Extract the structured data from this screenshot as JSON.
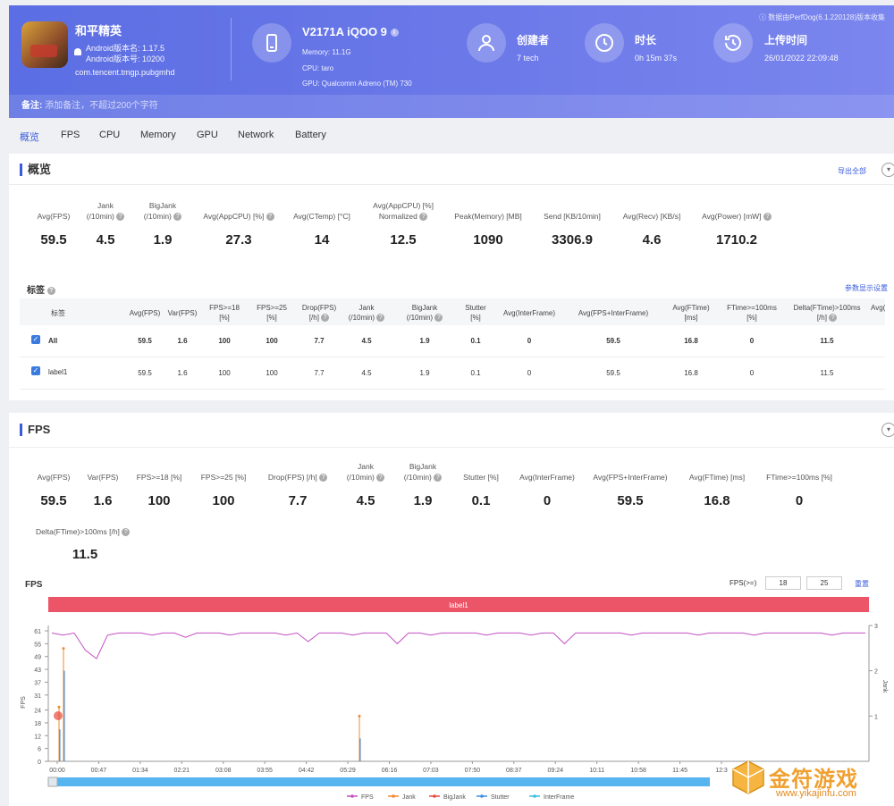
{
  "header": {
    "app_name": "和平精英",
    "android_version_name": "Android版本名: 1.17.5",
    "android_version_code": "Android版本号: 10200",
    "package": "com.tencent.tmgp.pubgmhd",
    "device_name": "V2171A iQOO 9",
    "memory": "Memory: 11.1G",
    "cpu": "CPU: taro",
    "gpu": "GPU: Qualcomm Adreno (TM) 730",
    "creator_label": "创建者",
    "creator_value": "7 tech",
    "duration_label": "时长",
    "duration_value": "0h 15m 37s",
    "upload_label": "上传时间",
    "upload_value": "26/01/2022 22:09:48",
    "source_note": "ⓘ 数据由PerfDog(6.1.220128)版本收集",
    "note_label": "备注:",
    "note_placeholder": "添加备注，不超过200个字符"
  },
  "tabs": [
    "概览",
    "FPS",
    "CPU",
    "Memory",
    "GPU",
    "Network",
    "Battery"
  ],
  "overview": {
    "title": "概览",
    "export_label": "导出全部",
    "metrics": [
      {
        "label": "Avg(FPS)",
        "value": "59.5"
      },
      {
        "label": "Jank (/10min)",
        "value": "4.5"
      },
      {
        "label": "BigJank (/10min)",
        "value": "1.9"
      },
      {
        "label": "Avg(AppCPU) [%]",
        "value": "27.3"
      },
      {
        "label": "Avg(CTemp) [°C]",
        "value": "14"
      },
      {
        "label": "Avg(AppCPU) [%] Normalized",
        "value": "12.5"
      },
      {
        "label": "Peak(Memory) [MB]",
        "value": "1090"
      },
      {
        "label": "Send [KB/10min]",
        "value": "3306.9"
      },
      {
        "label": "Avg(Recv) [KB/s]",
        "value": "4.6"
      },
      {
        "label": "Avg(Power) [mW]",
        "value": "1710.2"
      }
    ],
    "tags_label": "标签",
    "params_link": "参数显示设置",
    "table_headers": [
      "标签",
      "Avg(FPS)",
      "Var(FPS)",
      "FPS>=18 [%]",
      "FPS>=25 [%]",
      "Drop(FPS) [/h]",
      "Jank (/10min)",
      "BigJank (/10min)",
      "Stutter [%]",
      "Avg(InterFrame)",
      "Avg(FPS+InterFrame)",
      "Avg(FTime) [ms]",
      "FTime>=100ms [%]",
      "Delta(FTime)>100ms [/h]",
      "Avg("
    ],
    "rows": [
      {
        "name": "All",
        "cells": [
          "59.5",
          "1.6",
          "100",
          "100",
          "7.7",
          "4.5",
          "1.9",
          "0.1",
          "0",
          "59.5",
          "16.8",
          "0",
          "11.5"
        ]
      },
      {
        "name": "label1",
        "cells": [
          "59.5",
          "1.6",
          "100",
          "100",
          "7.7",
          "4.5",
          "1.9",
          "0.1",
          "0",
          "59.5",
          "16.8",
          "0",
          "11.5"
        ]
      }
    ]
  },
  "fps": {
    "title": "FPS",
    "metrics": [
      {
        "label": "Avg(FPS)",
        "value": "59.5"
      },
      {
        "label": "Var(FPS)",
        "value": "1.6"
      },
      {
        "label": "FPS>=18 [%]",
        "value": "100"
      },
      {
        "label": "FPS>=25 [%]",
        "value": "100"
      },
      {
        "label": "Drop(FPS) [/h]",
        "value": "7.7"
      },
      {
        "label": "Jank (/10min)",
        "value": "4.5"
      },
      {
        "label": "BigJank (/10min)",
        "value": "1.9"
      },
      {
        "label": "Stutter [%]",
        "value": "0.1"
      },
      {
        "label": "Avg(InterFrame)",
        "value": "0"
      },
      {
        "label": "Avg(FPS+InterFrame)",
        "value": "59.5"
      },
      {
        "label": "Avg(FTime) [ms]",
        "value": "16.8"
      },
      {
        "label": "FTime>=100ms [%]",
        "value": "0"
      }
    ],
    "delta_label": "Delta(FTime)>100ms [/h]",
    "delta_value": "11.5",
    "chart_label": "FPS",
    "threshold_label": "FPS(>=)",
    "threshold_1": "18",
    "threshold_2": "25",
    "reset_label": "重置"
  },
  "chart_data": {
    "type": "line",
    "band_label": "label1",
    "ylabel": "FPS",
    "y2label": "Jank",
    "y_ticks": [
      "0",
      "6",
      "12",
      "18",
      "24",
      "31",
      "37",
      "43",
      "49",
      "55",
      "61"
    ],
    "y2_ticks": [
      "1",
      "2",
      "3"
    ],
    "x_ticks": [
      "00:00",
      "00:47",
      "01:34",
      "02:21",
      "03:08",
      "03:55",
      "04:42",
      "05:29",
      "06:16",
      "07:03",
      "07:50",
      "08:37",
      "09:24",
      "10:11",
      "10:58",
      "11:45",
      "12:3"
    ],
    "ylim": [
      0,
      61
    ],
    "y2lim": [
      0,
      3
    ],
    "legend": [
      "FPS",
      "Jank",
      "BigJank",
      "Stutter",
      "InterFrame"
    ],
    "colors": {
      "FPS": "#c34fc2",
      "Jank": "#f08a2c",
      "BigJank": "#e84a3a",
      "Stutter": "#3a8de0",
      "InterFrame": "#35c0e0",
      "band": "#ec5568",
      "scroll": "#56b4ee"
    },
    "fps_series_approx": [
      60,
      59,
      60,
      52,
      48,
      59,
      60,
      60,
      60,
      59,
      60,
      60,
      58,
      60,
      60,
      60,
      59,
      60,
      60,
      60,
      60,
      59,
      60,
      56,
      60,
      60,
      60,
      59,
      60,
      60,
      60,
      55,
      60,
      60,
      59,
      60,
      60,
      60,
      60,
      59,
      60,
      60,
      60,
      59,
      60,
      60,
      55,
      60,
      60,
      60,
      60,
      60,
      59,
      60,
      60,
      60,
      60,
      60,
      59,
      60,
      60,
      60,
      60,
      59,
      60,
      60,
      60,
      60,
      60,
      60,
      59,
      60,
      60,
      60
    ],
    "jank_spikes": [
      {
        "x": "00:01",
        "value": 1.2
      },
      {
        "x": "00:03",
        "value": 2.1
      },
      {
        "x": "05:57",
        "value": 1.0
      }
    ]
  },
  "watermark": {
    "text": "金符游戏",
    "url": "www.yikajinfu.com"
  }
}
